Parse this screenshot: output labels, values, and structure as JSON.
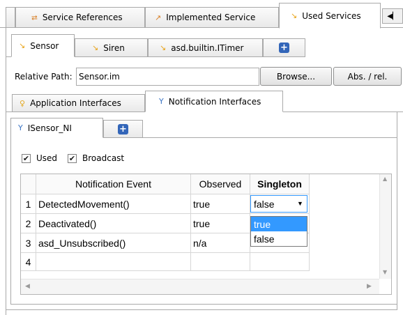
{
  "service_tabs": [
    {
      "label": "Service References",
      "icon": "service-reference-icon"
    },
    {
      "label": "Implemented Service",
      "icon": "implemented-service-icon"
    },
    {
      "label": "Used Services",
      "icon": "used-services-icon",
      "active": true
    }
  ],
  "used_service_tabs": [
    {
      "label": "Sensor",
      "icon": "used-service-icon",
      "active": true
    },
    {
      "label": "Siren",
      "icon": "used-service-icon"
    },
    {
      "label": "asd.builtin.ITimer",
      "icon": "used-service-icon"
    }
  ],
  "relative_path": {
    "label": "Relative Path:",
    "value": "Sensor.im"
  },
  "buttons": {
    "browse": "Browse...",
    "abs_rel": "Abs. / rel."
  },
  "interface_tabs": [
    {
      "label": "Application Interfaces",
      "icon": "application-interface-icon"
    },
    {
      "label": "Notification Interfaces",
      "icon": "notification-interface-icon",
      "active": true
    }
  ],
  "ni_tabs": [
    {
      "label": "ISensor_NI",
      "icon": "notification-interface-icon",
      "active": true
    }
  ],
  "checkboxes": [
    {
      "label": "Used",
      "checked": true
    },
    {
      "label": "Broadcast",
      "checked": true
    }
  ],
  "table": {
    "columns": [
      "Notification Event",
      "Observed",
      "Singleton"
    ],
    "rows": [
      {
        "num": "1",
        "event": "DetectedMovement()",
        "observed": "true",
        "singleton": "false"
      },
      {
        "num": "2",
        "event": "Deactivated()",
        "observed": "true",
        "singleton": ""
      },
      {
        "num": "3",
        "event": "asd_Unsubscribed()",
        "observed": "n/a",
        "singleton": "n/a"
      },
      {
        "num": "4",
        "event": "",
        "observed": "",
        "singleton": ""
      }
    ]
  },
  "dropdown": {
    "selected": "false",
    "options": [
      "true",
      "false"
    ],
    "highlighted": "true"
  },
  "colors": {
    "accent": "#3399ff",
    "plus_button": "#3366b9",
    "border": "#a9a9a9"
  }
}
